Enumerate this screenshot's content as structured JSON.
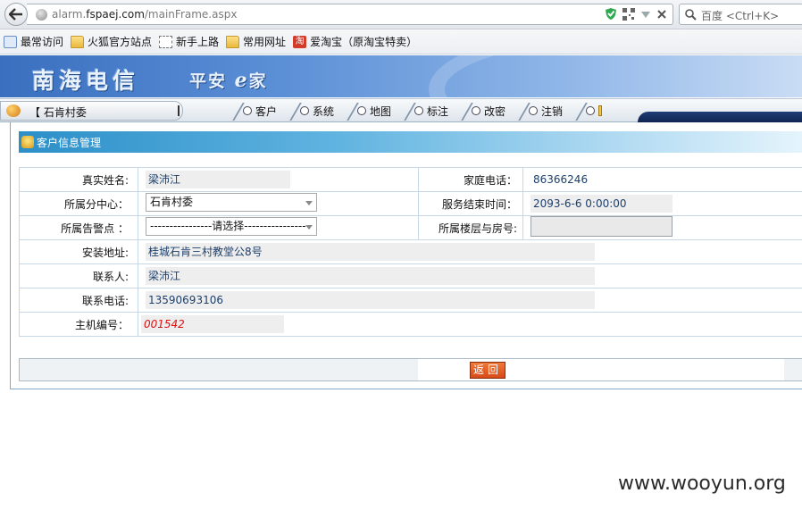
{
  "browser": {
    "url_prefix": "alarm.",
    "url_domain": "fspaej.com",
    "url_path": "/mainFrame.aspx",
    "search_placeholder": "百度 <Ctrl+K>"
  },
  "bookmarks": [
    {
      "label": "最常访问",
      "icon": "magnifier-icon"
    },
    {
      "label": "火狐官方站点",
      "icon": "folder-icon"
    },
    {
      "label": "新手上路",
      "icon": "dotted-page-icon"
    },
    {
      "label": "常用网址",
      "icon": "folder-icon"
    },
    {
      "label": "爱淘宝（原淘宝特卖）",
      "icon": "taobao-icon"
    }
  ],
  "taobao_icon_glyph": "淘",
  "banner": {
    "title": "南海电信",
    "subtitle": "平安",
    "subtitle_e": "e",
    "subtitle_end": "家"
  },
  "nav": {
    "user_label": "【 石肯村委",
    "tabs": [
      "客户",
      "系统",
      "地图",
      "标注",
      "改密",
      "注销"
    ]
  },
  "panel": {
    "title": "客户信息管理",
    "rows": {
      "real_name_label": "真实姓名:",
      "real_name": "梁沛江",
      "home_phone_label": "家庭电话：",
      "home_phone": "86366246",
      "branch_label": "所属分中心：",
      "branch_value": "石肯村委",
      "service_end_label": "服务结束时间：",
      "service_end": "2093-6-6 0:00:00",
      "alarm_point_label": "所属告警点 ：",
      "alarm_point_value": "----------------请选择----------------",
      "floor_room_label": "所属楼层与房号:",
      "floor_room_value": "",
      "address_label": "安装地址:",
      "address": "桂城石肯三村教堂公8号",
      "contact_label": "联系人:",
      "contact": "梁沛江",
      "contact_phone_label": "联系电话:",
      "contact_phone": "13590693106",
      "host_no_label": "主机编号：",
      "host_no": "001542"
    },
    "return_button": "返回"
  },
  "watermark": "www.wooyun.org",
  "colors": {
    "banner": "#3a6fbf",
    "header_bar": "#2c8fc8",
    "return_button": "#e4602a",
    "value_text": "#1d3f6b",
    "host_no_text": "#dd1111"
  }
}
